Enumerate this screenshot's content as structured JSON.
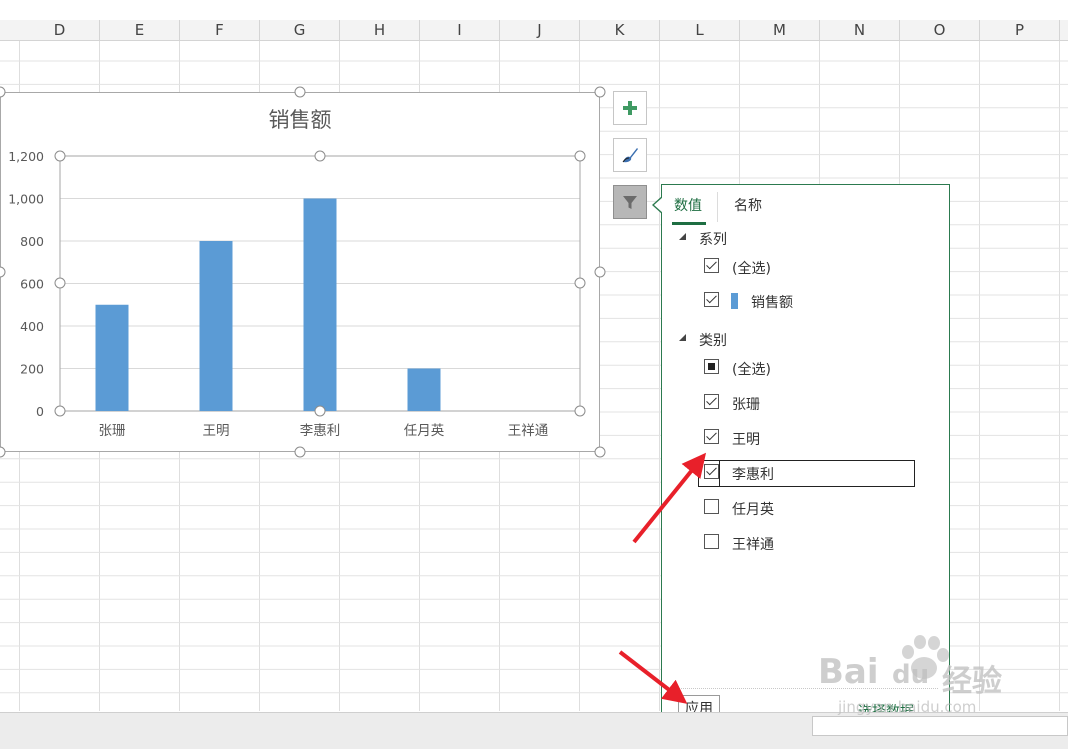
{
  "spreadsheet": {
    "columns": [
      "D",
      "E",
      "F",
      "G",
      "H",
      "I",
      "J",
      "K",
      "L",
      "M",
      "N",
      "O",
      "P"
    ]
  },
  "chart_data": {
    "type": "bar",
    "title": "销售额",
    "categories": [
      "张珊",
      "王明",
      "李惠利",
      "任月英",
      "王祥通"
    ],
    "values": [
      500,
      800,
      1000,
      200,
      0
    ],
    "ylim": [
      0,
      1200
    ],
    "yticks": [
      "1,200",
      "1,000",
      "800",
      "600",
      "400",
      "200",
      "0"
    ],
    "ytick_values": [
      1200,
      1000,
      800,
      600,
      400,
      200,
      0
    ],
    "color": "#5b9bd5",
    "grid": true,
    "legend": "none"
  },
  "side_buttons": {
    "add_icon": "plus-icon",
    "style_icon": "brush-icon",
    "filter_icon": "funnel-icon"
  },
  "filter_panel": {
    "tabs": [
      "数值",
      "名称"
    ],
    "active_tab": "数值",
    "series_group": {
      "label": "系列",
      "items": [
        {
          "label": "(全选)",
          "state": "checked"
        },
        {
          "label": "销售额",
          "state": "checked"
        }
      ]
    },
    "category_group": {
      "label": "类别",
      "items": [
        {
          "label": "(全选)",
          "state": "partial"
        },
        {
          "label": "张珊",
          "state": "checked"
        },
        {
          "label": "王明",
          "state": "checked"
        },
        {
          "label": "李惠利",
          "state": "checked"
        },
        {
          "label": "任月英",
          "state": "unchecked"
        },
        {
          "label": "王祥通",
          "state": "unchecked"
        }
      ]
    },
    "apply_label": "应用",
    "select_data_label": "选择数据..."
  },
  "watermark": {
    "brand": "Bai",
    "brand2": "du",
    "suffix": "经验",
    "url": "jingyan.baidu.com"
  }
}
